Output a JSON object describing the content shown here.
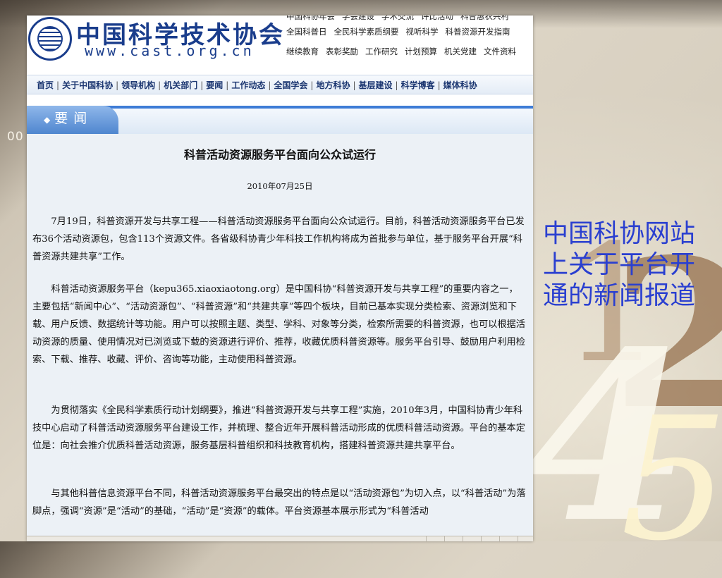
{
  "slide": {
    "number": "00",
    "caption": "中国科协网站上关于平台开通的新闻报道",
    "deco_digits": [
      "1",
      "2",
      "4",
      "5"
    ]
  },
  "site": {
    "logo_text": "中国科学技术协会",
    "url": "www.cast.org.cn",
    "top_links": [
      [
        "中国科协年会",
        "学会建设",
        "学术交流",
        "评比活动",
        "科普惠农兴村"
      ],
      [
        "全国科普日",
        "全民科学素质纲要",
        "视听科学",
        "科普资源开发指南"
      ],
      [
        "继续教育",
        "表彰奖励",
        "工作研究",
        "计划预算",
        "机关党建",
        "文件资料"
      ]
    ],
    "nav": [
      "首页",
      "关于中国科协",
      "领导机构",
      "机关部门",
      "要闻",
      "工作动态",
      "全国学会",
      "地方科协",
      "基层建设",
      "科学博客",
      "媒体科协"
    ],
    "section_label": "要闻"
  },
  "article": {
    "title": "科普活动资源服务平台面向公众试运行",
    "date": "2010年07月25日",
    "paragraphs": [
      "7月19日，科普资源开发与共享工程——科普活动资源服务平台面向公众试运行。目前，科普活动资源服务平台已发布36个活动资源包，包含113个资源文件。各省级科协青少年科技工作机构将成为首批参与单位，基于服务平台开展“科普资源共建共享”工作。",
      "科普活动资源服务平台（kepu365.xiaoxiaotong.org）是中国科协“科普资源开发与共享工程”的重要内容之一，主要包括“新闻中心”、“活动资源包”、“科普资源”和“共建共享”等四个板块，目前已基本实现分类检索、资源浏览和下载、用户反馈、数据统计等功能。用户可以按照主题、类型、学科、对象等分类，检索所需要的科普资源，也可以根据活动资源的质量、使用情况对已浏览或下载的资源进行评价、推荐，收藏优质科普资源等。服务平台引导、鼓励用户利用检索、下载、推荐、收藏、评价、咨询等功能，主动使用科普资源。",
      "为贯彻落实《全民科学素质行动计划纲要》，推进“科普资源开发与共享工程”实施，2010年3月，中国科协青少年科技中心启动了科普活动资源服务平台建设工作，并梳理、整合近年开展科普活动形成的优质科普活动资源。平台的基本定位是：向社会推介优质科普活动资源，服务基层科普组织和科技教育机构，搭建科普资源共建共享平台。",
      "与其他科普信息资源平台不同，科普活动资源服务平台最突出的特点是以“活动资源包”为切入点，以“科普活动”为落脚点，强调“资源”是“活动”的基础，“活动”是“资源”的载体。平台资源基本展示形式为“科普活动"
    ]
  }
}
